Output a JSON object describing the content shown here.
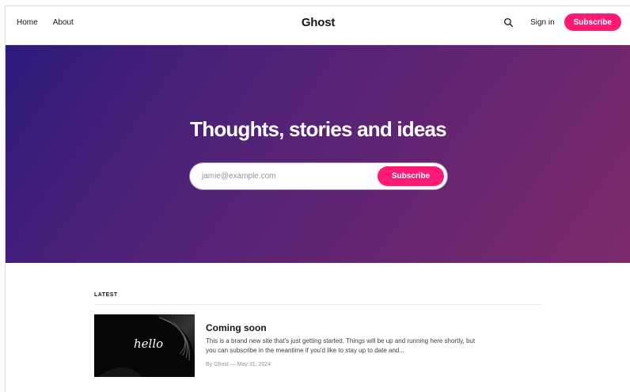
{
  "header": {
    "nav": [
      {
        "label": "Home"
      },
      {
        "label": "About"
      }
    ],
    "site_title": "Ghost",
    "search_icon": "search-icon",
    "sign_in": "Sign in",
    "subscribe": "Subscribe"
  },
  "hero": {
    "title": "Thoughts, stories and ideas",
    "email_placeholder": "jamie@example.com",
    "subscribe": "Subscribe",
    "gradient_colors": [
      "#2e1a7a",
      "#7d2a6b"
    ]
  },
  "latest": {
    "label": "LATEST",
    "posts": [
      {
        "thumbnail_text": "hello",
        "title": "Coming soon",
        "excerpt": "This is a brand new site that's just getting started. Things will be up and running here shortly, but you can subscribe in the meantime if you'd like to stay up to date and...",
        "meta": "By Ghost — May 31, 2024"
      }
    ]
  },
  "colors": {
    "accent": "#ff1a75",
    "text": "#15171a",
    "muted": "#8e9399"
  }
}
